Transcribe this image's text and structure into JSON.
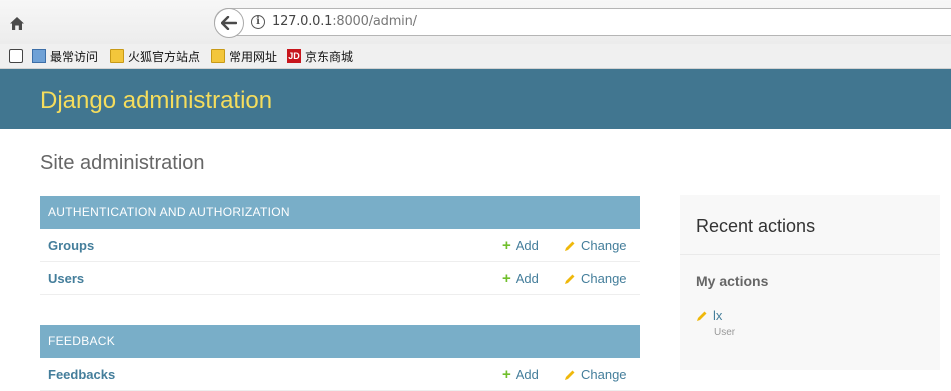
{
  "browser": {
    "url_host": "127.0.0.1",
    "url_rest": ":8000/admin/",
    "bookmarks": [
      {
        "label": "最常访问",
        "icon": "most-visited-icon"
      },
      {
        "label": "火狐官方站点",
        "icon": "folder-icon"
      },
      {
        "label": "常用网址",
        "icon": "folder-icon"
      },
      {
        "label": "京东商城",
        "icon": "jd-logo-icon",
        "logo_text": "JD"
      }
    ]
  },
  "header": {
    "branding": "Django administration"
  },
  "page": {
    "title": "Site administration"
  },
  "modules": [
    {
      "caption": "AUTHENTICATION AND AUTHORIZATION",
      "rows": [
        {
          "model": "Groups",
          "add": "Add",
          "change": "Change"
        },
        {
          "model": "Users",
          "add": "Add",
          "change": "Change"
        }
      ]
    },
    {
      "caption": "FEEDBACK",
      "rows": [
        {
          "model": "Feedbacks",
          "add": "Add",
          "change": "Change"
        }
      ]
    }
  ],
  "recent_actions": {
    "title": "Recent actions",
    "subtitle": "My actions",
    "items": [
      {
        "name": "lx",
        "type": "User",
        "icon": "pencil-icon"
      }
    ]
  },
  "colors": {
    "header_bg": "#417690",
    "branding": "#f5dd5d",
    "caption_bg": "#79aec8",
    "link": "#447e9b",
    "add_icon": "#70bf2b",
    "change_icon": "#efb80b"
  }
}
